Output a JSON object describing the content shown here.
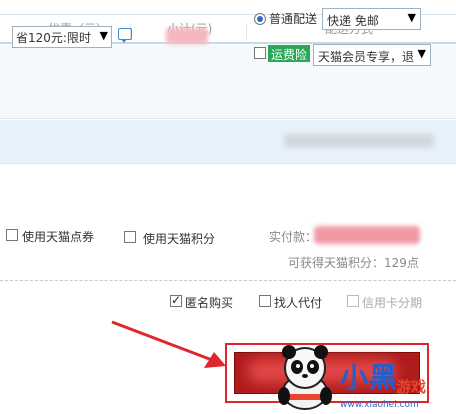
{
  "header": {
    "discount_col": "优惠（元）",
    "subtotal_col": "小计(元)",
    "shipping_col": "配送方式"
  },
  "order": {
    "discount_select": "省120元:限时",
    "shipping_radio_label": "普通配送",
    "shipping_select": "快递 免邮",
    "insurance_badge": "运费险",
    "member_select": "天猫会员专享，退"
  },
  "options": {
    "tmall_coupon_label": "使用天猫点券",
    "tmall_points_label": "使用天猫积分",
    "pay_label": "实付款：",
    "points_earned": "可获得天猫积分：129点"
  },
  "extras": {
    "anonymous_label": "匿名购买",
    "anonymous_checked": true,
    "proxy_label": "找人代付",
    "credit_installment_label": "信用卡分期"
  },
  "watermark": {
    "logo_text": "小黑",
    "logo_sub": "游戏",
    "url": "www.xiaohei.com"
  },
  "colors": {
    "accent_blue": "#2a6ac6",
    "header_bg": "#f4f9fd",
    "band_bg": "#e8f2fb",
    "insurance_green": "#2aa858",
    "highlight_red": "#e0262c",
    "button_red": "#b01c1c"
  }
}
